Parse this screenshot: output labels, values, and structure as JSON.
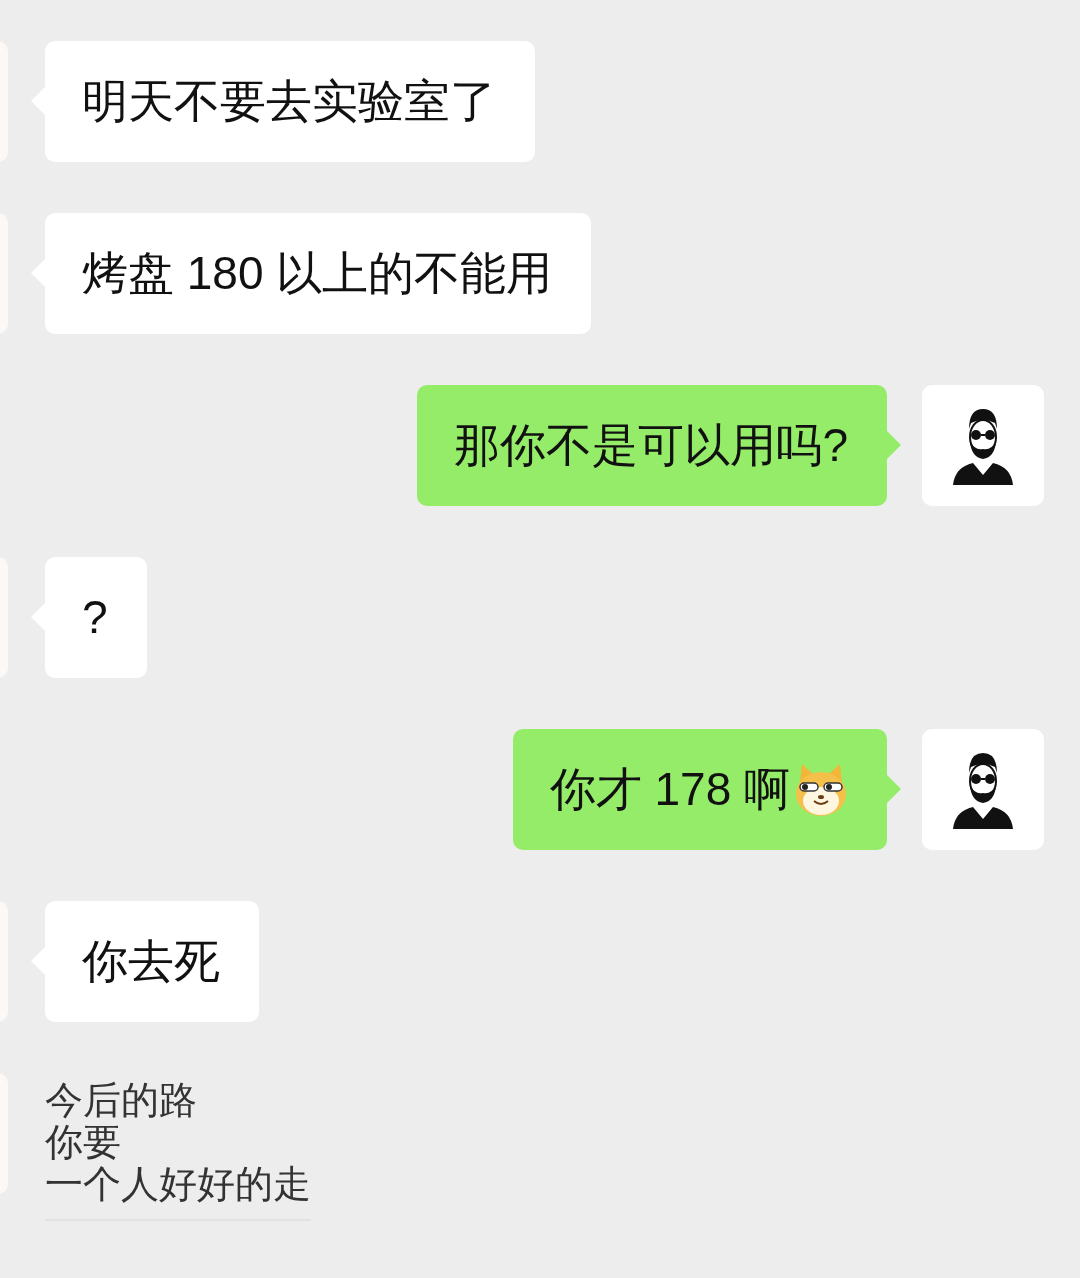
{
  "messages": [
    {
      "outgoing": false,
      "kind": "bubble",
      "text": "明天不要去实验室了"
    },
    {
      "outgoing": false,
      "kind": "bubble",
      "text": "烤盘 180 以上的不能用"
    },
    {
      "outgoing": true,
      "kind": "bubble",
      "text": "那你不是可以用吗?"
    },
    {
      "outgoing": false,
      "kind": "bubble",
      "text": "?"
    },
    {
      "outgoing": true,
      "kind": "bubble",
      "text": "你才 178 啊",
      "emoji": true
    },
    {
      "outgoing": false,
      "kind": "bubble",
      "text": "你去死"
    },
    {
      "outgoing": false,
      "kind": "plain",
      "lines": [
        "今后的路",
        "你要",
        "一个人好好的走"
      ]
    }
  ]
}
